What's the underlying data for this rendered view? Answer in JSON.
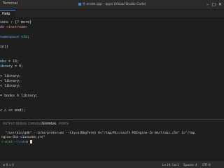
{
  "titlebar": {
    "menu_label": "Terminal",
    "window_title": "Ⓞ erode.cpp - apps (Visual Studio Code)",
    "min_glyph": "–",
    "max_glyph": "▢",
    "close_glyph": "✕"
  },
  "tab": {
    "label": "Help"
  },
  "editor": {
    "lines": [
      {
        "parts": [
          [
            "txt",
            "ions "
          ],
          [
            "txt",
            ": "
          ],
          [
            "txt",
            "{? more}"
          ]
        ]
      },
      {
        "parts": [
          [
            "pp",
            "de "
          ],
          [
            "str",
            "<iostream>"
          ]
        ]
      },
      {
        "parts": []
      },
      {
        "parts": [
          [
            "kw",
            "namespace "
          ],
          [
            "type",
            "std"
          ],
          [
            "txt",
            ";"
          ]
        ]
      },
      {
        "parts": []
      },
      {
        "parts": [
          [
            "txt",
            "in()"
          ]
        ]
      },
      {
        "parts": []
      },
      {
        "parts": []
      },
      {
        "parts": [
          [
            "id",
            "oks "
          ],
          [
            "txt",
            "= "
          ],
          [
            "num",
            "16"
          ],
          [
            "txt",
            ";"
          ]
        ]
      },
      {
        "parts": [
          [
            "id",
            "ibrary "
          ],
          [
            "txt",
            "= "
          ],
          [
            "num",
            "0"
          ],
          [
            "txt",
            ";"
          ]
        ]
      },
      {
        "parts": []
      },
      {
        "parts": [
          [
            "txt",
            "< library;"
          ]
        ]
      },
      {
        "parts": [
          [
            "txt",
            "< library;"
          ]
        ]
      },
      {
        "parts": [
          [
            "txt",
            "< library;"
          ]
        ]
      },
      {
        "parts": []
      },
      {
        "parts": [
          [
            "txt",
            "= books % library;"
          ]
        ]
      },
      {
        "parts": []
      },
      {
        "parts": []
      },
      {
        "parts": [
          [
            "txt",
            "< c << endl;"
          ]
        ]
      }
    ]
  },
  "panel": {
    "tabs": [
      "OUTPUT",
      "DEBUG CONSOLE",
      "TERMINAL",
      "PORTS"
    ],
    "active_tab": "TERMINAL"
  },
  "terminal": {
    "line1": "  \"/usr/bin/gdb\" --interpreter=mi --tty=${DbgTerm} 0<\"/tmp/Microsoft-MIEngine-In-bkrlrakz.c5e\" 1>\"/tmp",
    "line2": "ngine-Out-c1oeazbm.yre\"",
    "prompt_user": "r-mint",
    "prompt_path": ":~/code",
    "prompt_suffix": "$ "
  },
  "statusbar": {
    "left": "⊗ 0 ⚠ 0",
    "position": "Ln 19, Col 1",
    "spaces": "Spaces: 4",
    "encoding": "UTF-8"
  },
  "colors": {
    "accent": "#3c8fd6",
    "prompt_user": "#4ec94a",
    "background": "#1e1e1e"
  }
}
